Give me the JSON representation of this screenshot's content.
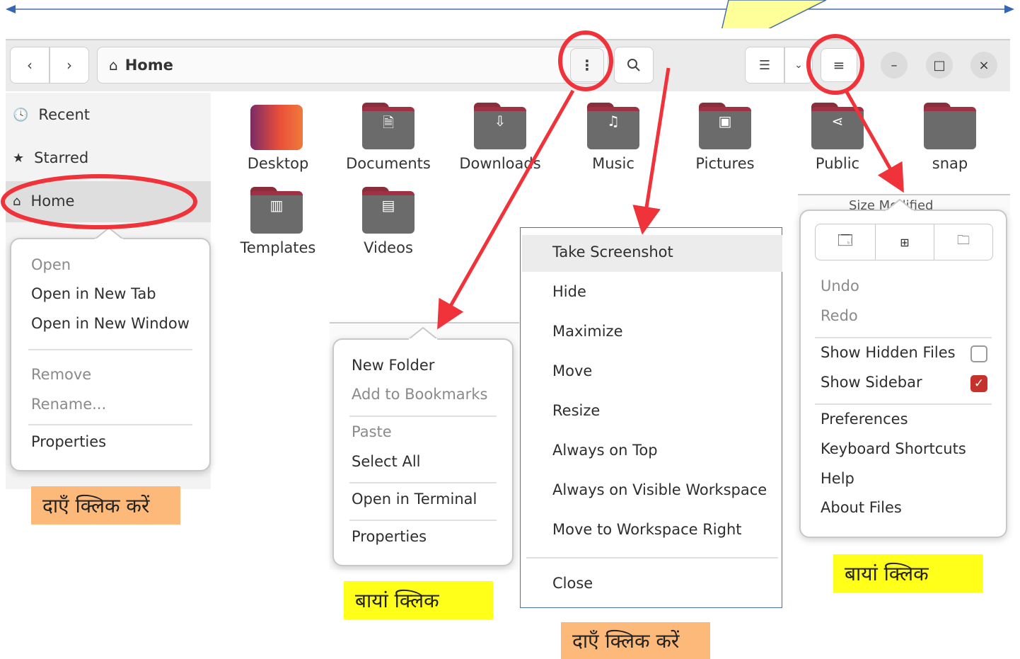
{
  "header": {
    "path_label": "Home",
    "home_icon": "home-icon",
    "back_icon": "chevron-left-icon",
    "forward_icon": "chevron-right-icon",
    "more_icon": "kebab-vertical-icon",
    "search_icon": "search-icon",
    "view_icon": "list-view-icon",
    "view_dropdown_icon": "chevron-down-icon",
    "menu_icon": "hamburger-menu-icon",
    "minimize": "–",
    "maximize": "□",
    "close": "×"
  },
  "sidebar": {
    "items": [
      {
        "label": "Recent",
        "icon": "clock-icon"
      },
      {
        "label": "Starred",
        "icon": "star-icon"
      },
      {
        "label": "Home",
        "icon": "home-icon"
      }
    ]
  },
  "files": [
    {
      "label": "Desktop",
      "icon": "desktop-folder-icon"
    },
    {
      "label": "Documents",
      "icon": "document-icon"
    },
    {
      "label": "Downloads",
      "icon": "download-icon"
    },
    {
      "label": "Music",
      "icon": "music-note-icon"
    },
    {
      "label": "Pictures",
      "icon": "picture-icon"
    },
    {
      "label": "Public",
      "icon": "share-icon"
    },
    {
      "label": "snap",
      "icon": "folder-icon"
    },
    {
      "label": "Templates",
      "icon": "template-icon"
    },
    {
      "label": "Videos",
      "icon": "film-icon"
    }
  ],
  "sidebar_context_menu": {
    "items": [
      "Open",
      "Open in New Tab",
      "Open in New Window",
      "Remove",
      "Rename...",
      "Properties"
    ]
  },
  "folder_menu": {
    "items": [
      "New Folder",
      "Add to Bookmarks",
      "Paste",
      "Select All",
      "Open in Terminal",
      "Properties"
    ]
  },
  "window_menu": {
    "items": [
      "Take Screenshot",
      "Hide",
      "Maximize",
      "Move",
      "Resize",
      "Always on Top",
      "Always on Visible Workspace",
      "Move to Workspace Right",
      "Close"
    ]
  },
  "main_menu": {
    "icons": [
      "new-window-icon",
      "new-tab-icon",
      "new-folder-icon"
    ],
    "items": [
      "Undo",
      "Redo",
      "Show Hidden Files",
      "Show Sidebar",
      "Preferences",
      "Keyboard Shortcuts",
      "Help",
      "About Files"
    ],
    "show_hidden_files": false,
    "show_sidebar": true,
    "partial_header": "Size  Modified"
  },
  "notes": {
    "right_click_1": "दाएँ क्लिक करें",
    "left_click_1": "बायां क्लिक",
    "right_click_2": "दाएँ क्लिक करें",
    "left_click_2": "बायां क्लिक"
  },
  "colors": {
    "annotation_red": "#f0333a",
    "note_orange": "#fdb97a",
    "note_yellow": "#ffff1a",
    "callout_yellow": "#ffff99",
    "folder_tab": "#a03043",
    "folder_body": "#6b6b6b",
    "checkbox_checked": "#c7312b"
  }
}
